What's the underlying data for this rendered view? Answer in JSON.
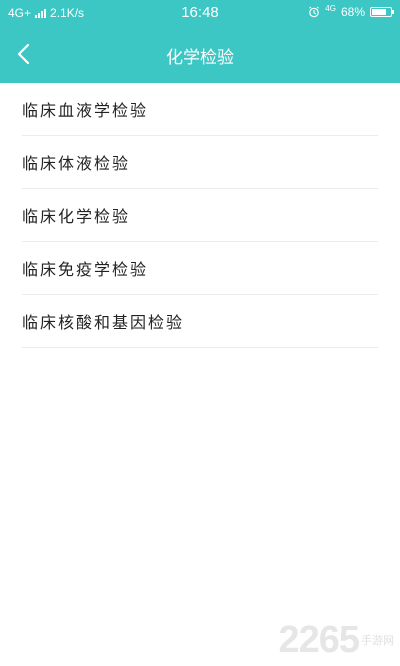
{
  "status_bar": {
    "network": "4G+",
    "speed": "2.1K/s",
    "time": "16:48",
    "net_badge": "4G",
    "battery": "68%"
  },
  "header": {
    "title": "化学检验",
    "background_color": "#3cc7c4"
  },
  "list": {
    "items": [
      {
        "label": "临床血液学检验"
      },
      {
        "label": "临床体液检验"
      },
      {
        "label": "临床化学检验"
      },
      {
        "label": "临床免疫学检验"
      },
      {
        "label": "临床核酸和基因检验"
      }
    ]
  },
  "watermark": {
    "number": "2265",
    "suffix": "手游网"
  },
  "icons": {
    "back": "chevron-left-icon",
    "alarm": "alarm-icon",
    "signal": "signal-icon",
    "battery": "battery-icon"
  }
}
